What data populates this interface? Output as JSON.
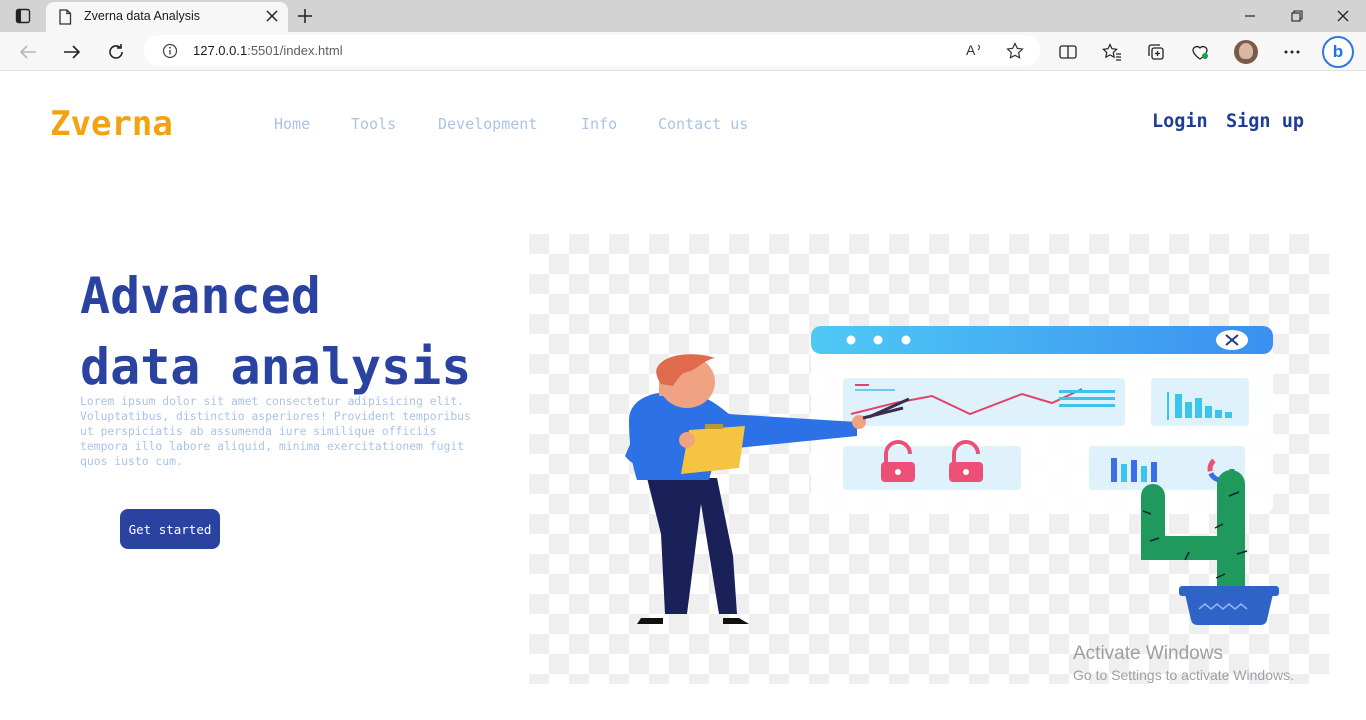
{
  "browser": {
    "tab_title": "Zverna data Analysis",
    "url_host": "127.0.0.1",
    "url_rest": ":5501/index.html",
    "icons": [
      "tab-actions-icon",
      "page-icon",
      "close-icon",
      "plus-icon",
      "minimize-icon",
      "restore-icon",
      "window-close-icon",
      "back-icon",
      "forward-icon",
      "refresh-icon",
      "info-icon",
      "read-aloud-icon",
      "favorite-star-icon",
      "split-screen-icon",
      "favorites-icon",
      "collections-icon",
      "performance-icon",
      "profile-avatar",
      "more-icon",
      "bing-icon"
    ]
  },
  "site": {
    "brand": "Zverna",
    "nav": [
      "Home",
      "Tools",
      "Development",
      "Info",
      "Contact us"
    ],
    "login": "Login",
    "signup": "Sign up",
    "hero_title": "Advanced\ndata analysis",
    "hero_text": "Lorem ipsum dolor sit amet consectetur adipisicing elit. Voluptatibus, distinctio asperiores! Provident temporibus ut perspiciatis ab assumenda iure similique officiis tempora illo labore aliquid, minima exercitationem fugit quos iusto cum.",
    "cta": "Get started",
    "colors": {
      "brand": "#f2a30f",
      "primary": "#2a43a0",
      "nav": "#a9c3ea"
    }
  },
  "os_watermark": {
    "line1": "Activate Windows",
    "line2": "Go to Settings to activate Windows."
  }
}
